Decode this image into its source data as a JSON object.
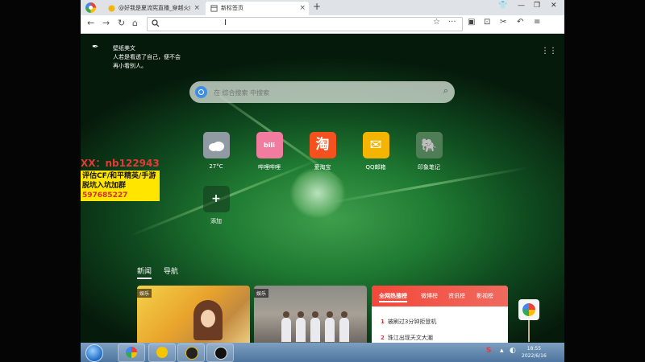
{
  "browser": {
    "tabs": [
      {
        "title": "@好我是夏流宪直播_穿越火线",
        "close": "×"
      },
      {
        "title": "新标签页",
        "close": "×"
      }
    ],
    "new_tab": "+",
    "url": ""
  },
  "wallpaper_quote": {
    "title": "壁纸美文",
    "text": "人若是看透了自己，便不会再小看别人。"
  },
  "search": {
    "placeholder": "在 综合搜索 中搜索"
  },
  "shortcuts": [
    {
      "label": "27°C",
      "icon": "weather-cloud-icon",
      "color": "#8f9aa3",
      "glyph": ""
    },
    {
      "label": "哔哩哔哩",
      "icon": "bilibili-icon",
      "color": "#f17ca0",
      "glyph": "bili"
    },
    {
      "label": "爱淘宝",
      "icon": "taobao-icon",
      "color": "#f4511e",
      "glyph": "淘"
    },
    {
      "label": "QQ邮箱",
      "icon": "mail-icon",
      "color": "#f5b400",
      "glyph": "✉"
    },
    {
      "label": "印象笔记",
      "icon": "evernote-icon",
      "color": "#4f7d55",
      "glyph": "🐘"
    },
    {
      "label": "添加",
      "icon": "add-icon",
      "color": "",
      "glyph": "+"
    }
  ],
  "news": {
    "tabs": [
      "新闻",
      "导航"
    ],
    "cards": [
      {
        "tag": "娱乐"
      },
      {
        "tag": "娱乐"
      }
    ]
  },
  "hot": {
    "tabs": [
      "全网热搜榜",
      "微博榜",
      "资讯榜",
      "影视榜"
    ],
    "items": [
      {
        "rank": "1",
        "text": "被刷过3分钟拒登机"
      },
      {
        "rank": "2",
        "text": "珠江出现天文大潮"
      }
    ]
  },
  "promo": {
    "top": "XX：nb122943",
    "line1": "评估CF/和平精英/手游",
    "line2": "脱坑入坑加群",
    "line2_num": "597685227"
  },
  "taskbar": {
    "time": "18:55",
    "date": "2022/6/16"
  }
}
